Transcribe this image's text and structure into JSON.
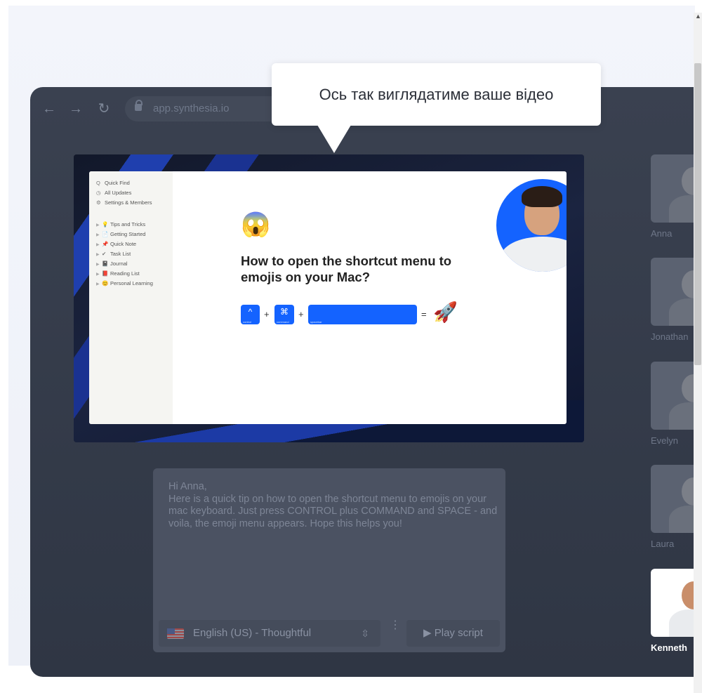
{
  "browser": {
    "url": "app.synthesia.io"
  },
  "tooltip": {
    "text": "Ось так виглядатиме ваше відео"
  },
  "slide": {
    "sidebar_items": [
      {
        "icon": "Q",
        "label": "Quick Find"
      },
      {
        "icon": "◷",
        "label": "All Updates"
      },
      {
        "icon": "⚙",
        "label": "Settings & Members"
      },
      {
        "icon": "💡",
        "label": "Tips and Tricks"
      },
      {
        "icon": "📄",
        "label": "Getting Started"
      },
      {
        "icon": "📌",
        "label": "Quick Note"
      },
      {
        "icon": "✔",
        "label": "Task List"
      },
      {
        "icon": "📓",
        "label": "Journal"
      },
      {
        "icon": "📕",
        "label": "Reading List"
      },
      {
        "icon": "😊",
        "label": "Personal Learning"
      }
    ],
    "emoji": "😱",
    "title": "How to open the shortcut menu to emojis on your Mac?",
    "keys": [
      "^",
      "⌘",
      ""
    ],
    "key_captions": [
      "control",
      "command",
      "spacebar"
    ],
    "plus": "+",
    "equals": "=",
    "rocket": "🚀"
  },
  "script": {
    "text": "Hi Anna,\nHere is a quick tip on how to open the shortcut menu to emojis on your mac keyboard. Just press CONTROL plus COMMAND and SPACE - and voila, the emoji menu appears. Hope this helps you!",
    "language": "English (US) - Thoughtful",
    "play_label": "▶  Play script",
    "more": "⋮"
  },
  "avatars": [
    {
      "name": "Anna"
    },
    {
      "name": "Jonathan"
    },
    {
      "name": "Evelyn"
    },
    {
      "name": "Laura"
    },
    {
      "name": "Kenneth",
      "selected": true
    }
  ],
  "colors": {
    "accent": "#1463ff",
    "browser_bg": "#363d4b",
    "page_bg": "#f1f3f9"
  }
}
